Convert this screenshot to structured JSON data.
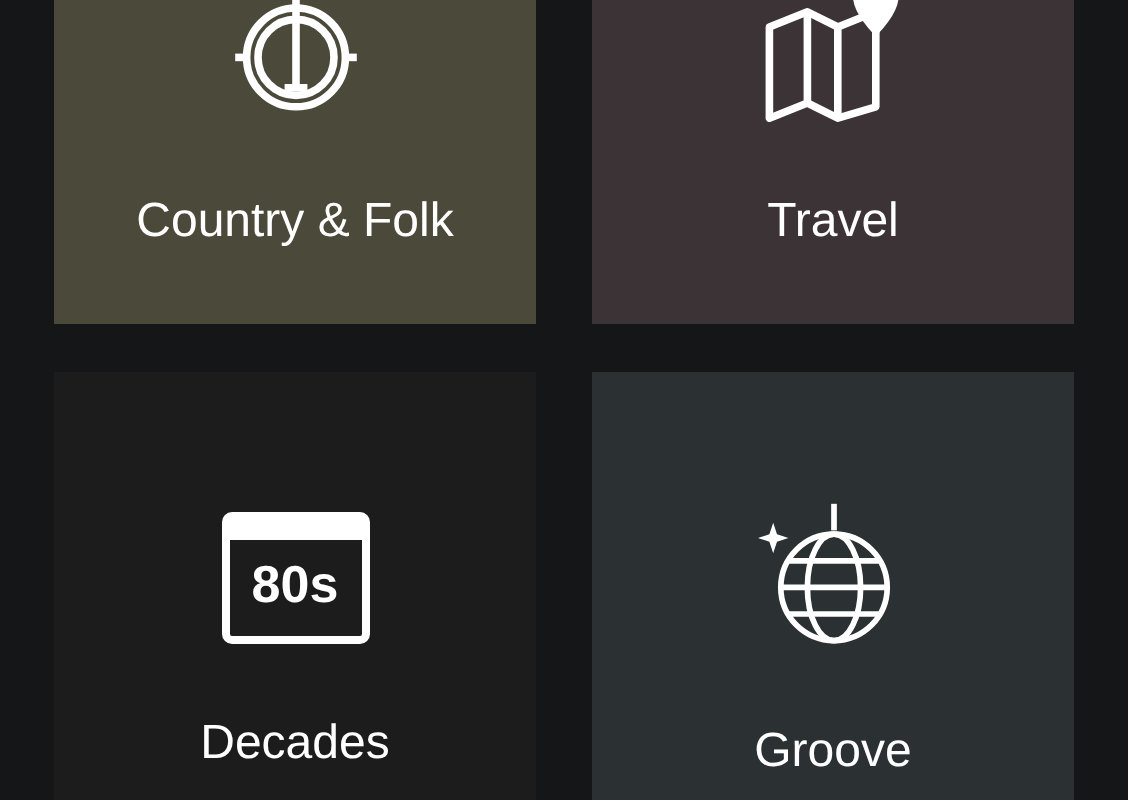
{
  "tiles": [
    {
      "label": "Country & Folk",
      "kind": "banjo"
    },
    {
      "label": "Travel",
      "kind": "map"
    },
    {
      "label": "Decades",
      "kind": "calendar",
      "icon_text": "80s"
    },
    {
      "label": "Groove",
      "kind": "disco"
    }
  ]
}
